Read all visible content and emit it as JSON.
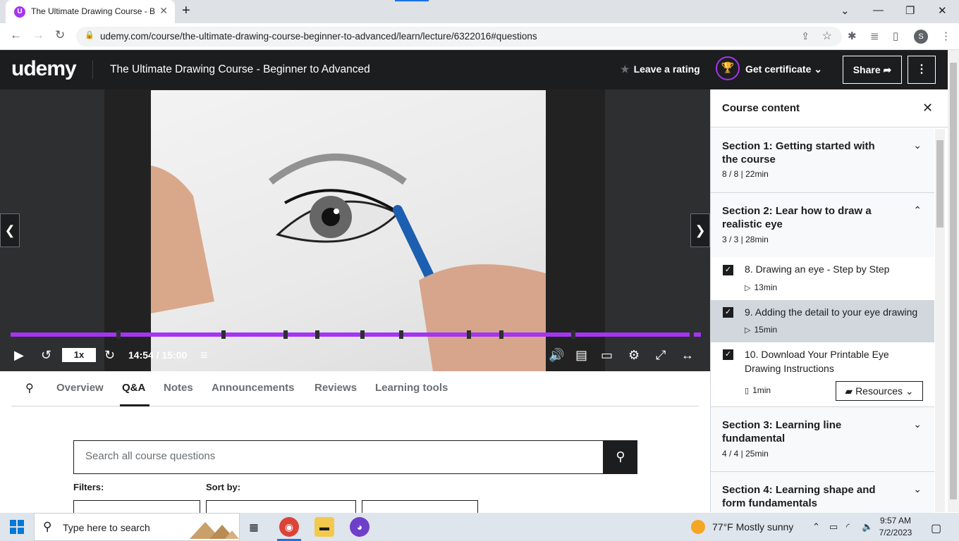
{
  "browser": {
    "tab_title": "The Ultimate Drawing Course - B",
    "tab_favicon": "U",
    "url": "udemy.com/course/the-ultimate-drawing-course-beginner-to-advanced/learn/lecture/6322016#questions",
    "profile_initial": "S"
  },
  "header": {
    "logo": "udemy",
    "course_title": "The Ultimate Drawing Course - Beginner to Advanced",
    "rating_label": "Leave a rating",
    "certificate_label": "Get certificate",
    "share_label": "Share",
    "brand_color": "#a435f0"
  },
  "player": {
    "speed": "1x",
    "time": "14:54 / 15:00",
    "progress": 0.993
  },
  "tabs": {
    "items": [
      "Overview",
      "Q&A",
      "Notes",
      "Announcements",
      "Reviews",
      "Learning tools"
    ],
    "active": "Q&A"
  },
  "qa": {
    "search_placeholder": "Search all course questions",
    "filters_label": "Filters:",
    "sort_label": "Sort by:"
  },
  "sidebar": {
    "title": "Course content",
    "sections": [
      {
        "title": "Section 1: Getting started with the course",
        "meta": "8 / 8 | 22min",
        "expanded": false
      },
      {
        "title": "Section 2: Lear how to draw a realistic eye",
        "meta": "3 / 3 | 28min",
        "expanded": true
      },
      {
        "title": "Section 3: Learning line fundamental",
        "meta": "4 / 4 | 25min",
        "expanded": false
      },
      {
        "title": "Section 4: Learning shape and form fundamentals",
        "meta": "",
        "expanded": false
      }
    ],
    "lectures": [
      {
        "title": "8. Drawing an eye - Step by Step",
        "duration": "13min",
        "checked": true,
        "current": false,
        "type": "video"
      },
      {
        "title": "9. Adding the detail to your eye drawing",
        "duration": "15min",
        "checked": true,
        "current": true,
        "type": "video"
      },
      {
        "title": "10. Download Your Printable Eye Drawing Instructions",
        "duration": "1min",
        "checked": true,
        "current": false,
        "type": "file"
      }
    ],
    "resources_label": "Resources"
  },
  "taskbar": {
    "search_placeholder": "Type here to search",
    "weather": "77°F  Mostly sunny",
    "time": "9:57 AM",
    "date": "7/2/2023"
  }
}
